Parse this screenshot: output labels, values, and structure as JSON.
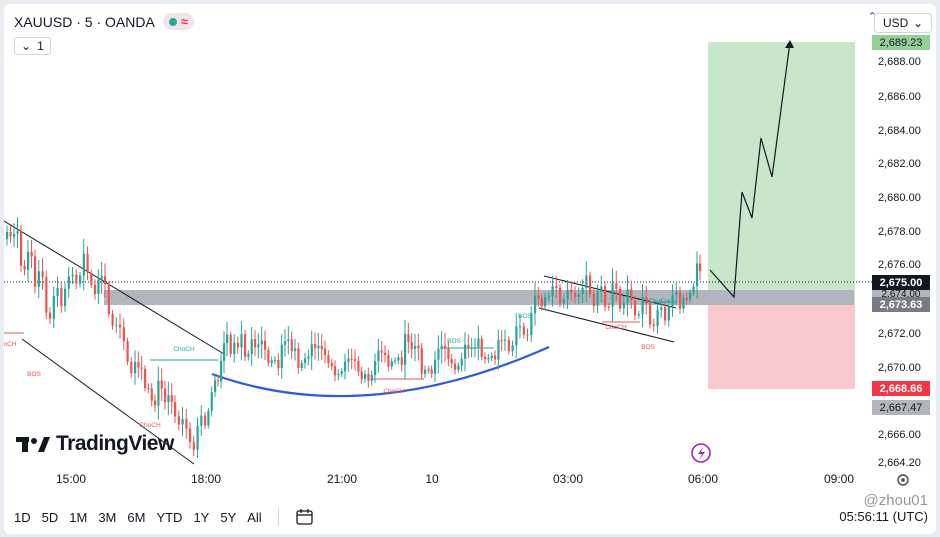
{
  "header": {
    "symbol": "XAUUSD · 5 · OANDA",
    "interval_chip": "1"
  },
  "currency_selector": {
    "value": "USD"
  },
  "logo": {
    "text": "TradingView"
  },
  "chart_data": {
    "type": "candlestick",
    "y_axis_ticks": [
      "2,688.00",
      "2,686.00",
      "2,684.00",
      "2,682.00",
      "2,680.00",
      "2,678.00",
      "2,676.00",
      "2,672.00",
      "2,670.00",
      "2,666.00",
      "2,664.20"
    ],
    "x_axis_ticks": [
      "15:00",
      "18:00",
      "21:00",
      "10",
      "03:00",
      "06:00",
      "09:00"
    ],
    "ylim": [
      2664.2,
      2689.7
    ],
    "price_labels": {
      "target": "2,689.23",
      "current": "2,675.00",
      "hidden": "2,674.00",
      "entry": "2,673.63",
      "stop": "2,668.66",
      "low": "2,667.47"
    },
    "annotations": [
      "ChoCH",
      "BOS",
      "ChoCH",
      "ChoCH",
      "BOS",
      "ChoCH",
      "ChoCH",
      "BOS",
      "BOS",
      "oCH"
    ],
    "colors": {
      "up": "#26a69a",
      "down": "#ef5350",
      "profit_zone": "#c8e6c9",
      "loss_zone": "#f8c8cc",
      "curve": "#2962ff"
    }
  },
  "toolbar": {
    "ranges": [
      "1D",
      "5D",
      "1M",
      "3M",
      "6M",
      "YTD",
      "1Y",
      "5Y",
      "All"
    ]
  },
  "status": {
    "clock": "05:56:11 (UTC)"
  },
  "watermark": "@zhou01"
}
